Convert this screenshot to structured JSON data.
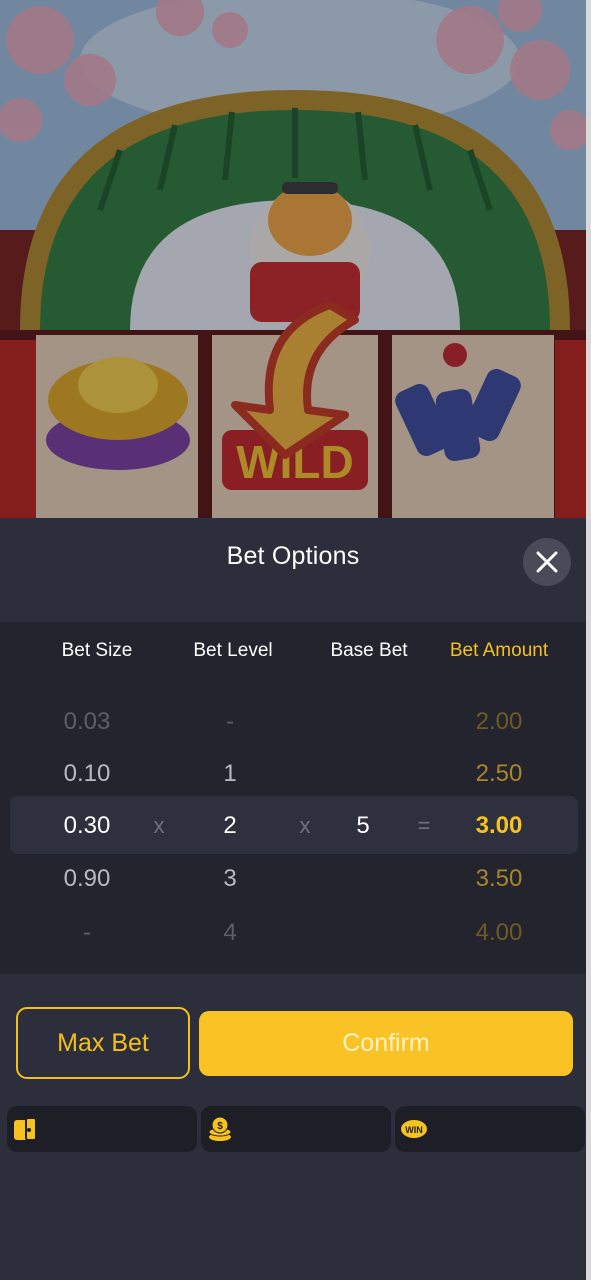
{
  "panel": {
    "title": "Bet Options"
  },
  "columns": {
    "bet_size": "Bet Size",
    "bet_level": "Bet Level",
    "base_bet": "Base Bet",
    "bet_amount": "Bet Amount"
  },
  "rows": [
    {
      "bet_size": "0.03",
      "bet_level": "-",
      "bet_amount": "2.00"
    },
    {
      "bet_size": "0.10",
      "bet_level": "1",
      "bet_amount": "2.50"
    },
    {
      "bet_size": "0.30",
      "bet_level": "2",
      "base_bet": "5",
      "bet_amount": "3.00"
    },
    {
      "bet_size": "0.90",
      "bet_level": "3",
      "bet_amount": "3.50"
    },
    {
      "bet_size": "-",
      "bet_level": "4",
      "bet_amount": "4.00"
    }
  ],
  "operators": {
    "multiply": "x",
    "equals": "="
  },
  "buttons": {
    "max_bet": "Max Bet",
    "confirm": "Confirm"
  },
  "info_bar": [
    {
      "icon": "wallet-icon",
      "value": ""
    },
    {
      "icon": "coin-stack-icon",
      "value": ""
    },
    {
      "icon": "win-icon",
      "value": ""
    }
  ],
  "colors": {
    "accent": "#f9c325",
    "panel_bg": "#2d2e3b",
    "table_bg": "#23242e"
  }
}
